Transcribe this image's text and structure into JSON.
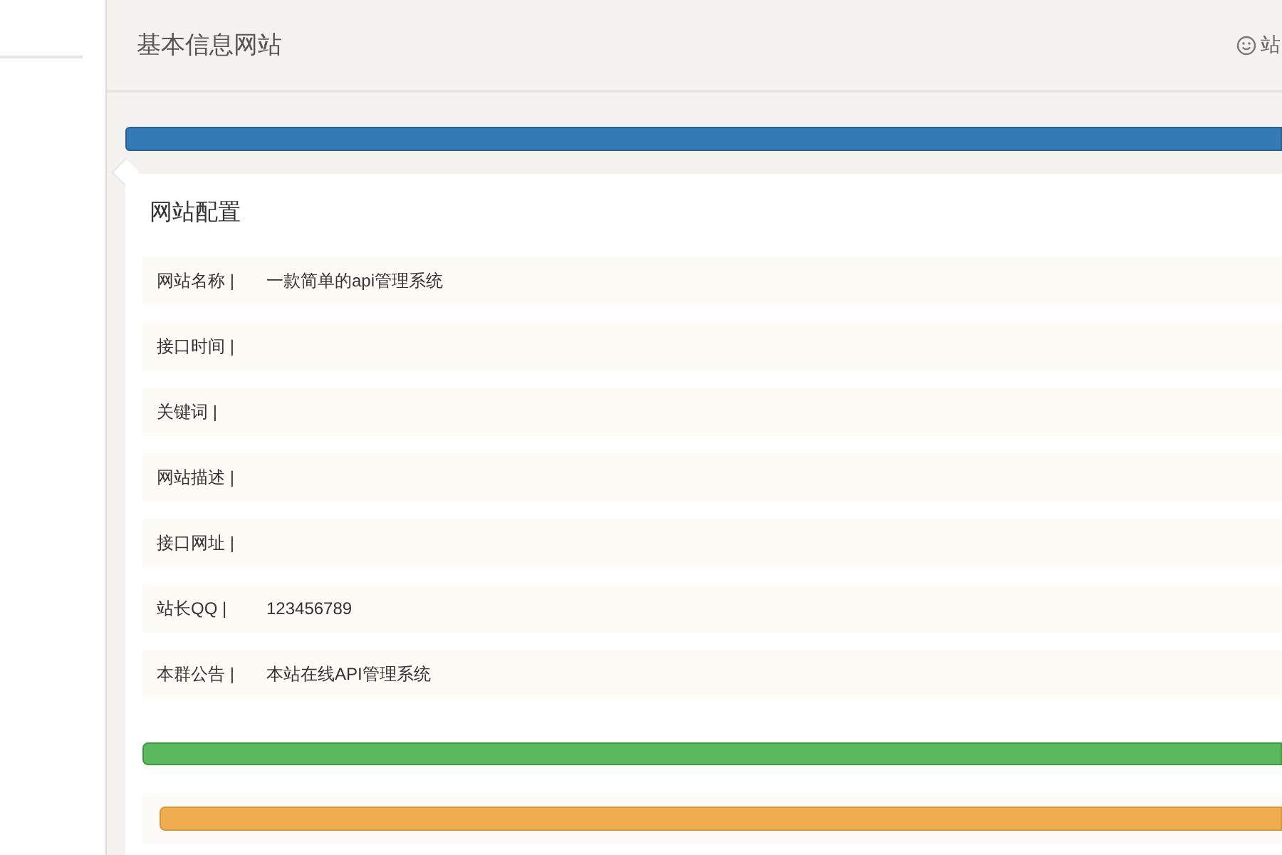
{
  "header": {
    "title": "基本信息网站",
    "user_label": "站"
  },
  "progress_bars": [
    {
      "level": 1
    },
    {
      "level": 1
    },
    {
      "level": 1
    }
  ],
  "panel": {
    "title": "网站配置",
    "rows": [
      {
        "label": "网站名称 |",
        "value": "一款简单的api管理系统"
      },
      {
        "label": "接口时间 |"
      },
      {
        "label": "关键词 |"
      },
      {
        "label": "网站描述 |"
      },
      {
        "label": "接口网址 |"
      },
      {
        "label": "站长QQ |",
        "value": "123456789"
      },
      {
        "label": "本群公告 |",
        "value": "本站在线API管理系统"
      }
    ]
  }
}
